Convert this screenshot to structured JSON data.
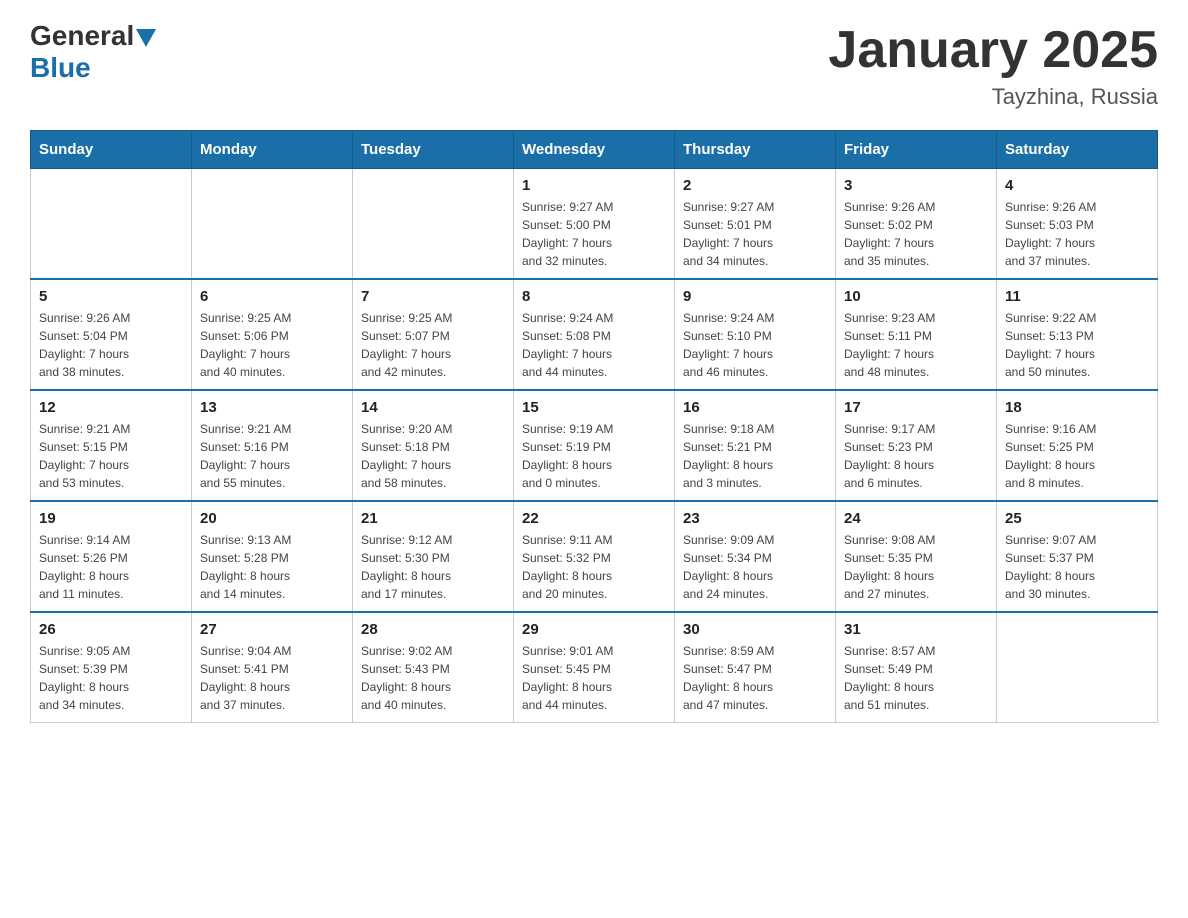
{
  "header": {
    "logo_general": "General",
    "logo_blue": "Blue",
    "title": "January 2025",
    "subtitle": "Tayzhina, Russia"
  },
  "weekdays": [
    "Sunday",
    "Monday",
    "Tuesday",
    "Wednesday",
    "Thursday",
    "Friday",
    "Saturday"
  ],
  "weeks": [
    [
      {
        "day": "",
        "info": ""
      },
      {
        "day": "",
        "info": ""
      },
      {
        "day": "",
        "info": ""
      },
      {
        "day": "1",
        "info": "Sunrise: 9:27 AM\nSunset: 5:00 PM\nDaylight: 7 hours\nand 32 minutes."
      },
      {
        "day": "2",
        "info": "Sunrise: 9:27 AM\nSunset: 5:01 PM\nDaylight: 7 hours\nand 34 minutes."
      },
      {
        "day": "3",
        "info": "Sunrise: 9:26 AM\nSunset: 5:02 PM\nDaylight: 7 hours\nand 35 minutes."
      },
      {
        "day": "4",
        "info": "Sunrise: 9:26 AM\nSunset: 5:03 PM\nDaylight: 7 hours\nand 37 minutes."
      }
    ],
    [
      {
        "day": "5",
        "info": "Sunrise: 9:26 AM\nSunset: 5:04 PM\nDaylight: 7 hours\nand 38 minutes."
      },
      {
        "day": "6",
        "info": "Sunrise: 9:25 AM\nSunset: 5:06 PM\nDaylight: 7 hours\nand 40 minutes."
      },
      {
        "day": "7",
        "info": "Sunrise: 9:25 AM\nSunset: 5:07 PM\nDaylight: 7 hours\nand 42 minutes."
      },
      {
        "day": "8",
        "info": "Sunrise: 9:24 AM\nSunset: 5:08 PM\nDaylight: 7 hours\nand 44 minutes."
      },
      {
        "day": "9",
        "info": "Sunrise: 9:24 AM\nSunset: 5:10 PM\nDaylight: 7 hours\nand 46 minutes."
      },
      {
        "day": "10",
        "info": "Sunrise: 9:23 AM\nSunset: 5:11 PM\nDaylight: 7 hours\nand 48 minutes."
      },
      {
        "day": "11",
        "info": "Sunrise: 9:22 AM\nSunset: 5:13 PM\nDaylight: 7 hours\nand 50 minutes."
      }
    ],
    [
      {
        "day": "12",
        "info": "Sunrise: 9:21 AM\nSunset: 5:15 PM\nDaylight: 7 hours\nand 53 minutes."
      },
      {
        "day": "13",
        "info": "Sunrise: 9:21 AM\nSunset: 5:16 PM\nDaylight: 7 hours\nand 55 minutes."
      },
      {
        "day": "14",
        "info": "Sunrise: 9:20 AM\nSunset: 5:18 PM\nDaylight: 7 hours\nand 58 minutes."
      },
      {
        "day": "15",
        "info": "Sunrise: 9:19 AM\nSunset: 5:19 PM\nDaylight: 8 hours\nand 0 minutes."
      },
      {
        "day": "16",
        "info": "Sunrise: 9:18 AM\nSunset: 5:21 PM\nDaylight: 8 hours\nand 3 minutes."
      },
      {
        "day": "17",
        "info": "Sunrise: 9:17 AM\nSunset: 5:23 PM\nDaylight: 8 hours\nand 6 minutes."
      },
      {
        "day": "18",
        "info": "Sunrise: 9:16 AM\nSunset: 5:25 PM\nDaylight: 8 hours\nand 8 minutes."
      }
    ],
    [
      {
        "day": "19",
        "info": "Sunrise: 9:14 AM\nSunset: 5:26 PM\nDaylight: 8 hours\nand 11 minutes."
      },
      {
        "day": "20",
        "info": "Sunrise: 9:13 AM\nSunset: 5:28 PM\nDaylight: 8 hours\nand 14 minutes."
      },
      {
        "day": "21",
        "info": "Sunrise: 9:12 AM\nSunset: 5:30 PM\nDaylight: 8 hours\nand 17 minutes."
      },
      {
        "day": "22",
        "info": "Sunrise: 9:11 AM\nSunset: 5:32 PM\nDaylight: 8 hours\nand 20 minutes."
      },
      {
        "day": "23",
        "info": "Sunrise: 9:09 AM\nSunset: 5:34 PM\nDaylight: 8 hours\nand 24 minutes."
      },
      {
        "day": "24",
        "info": "Sunrise: 9:08 AM\nSunset: 5:35 PM\nDaylight: 8 hours\nand 27 minutes."
      },
      {
        "day": "25",
        "info": "Sunrise: 9:07 AM\nSunset: 5:37 PM\nDaylight: 8 hours\nand 30 minutes."
      }
    ],
    [
      {
        "day": "26",
        "info": "Sunrise: 9:05 AM\nSunset: 5:39 PM\nDaylight: 8 hours\nand 34 minutes."
      },
      {
        "day": "27",
        "info": "Sunrise: 9:04 AM\nSunset: 5:41 PM\nDaylight: 8 hours\nand 37 minutes."
      },
      {
        "day": "28",
        "info": "Sunrise: 9:02 AM\nSunset: 5:43 PM\nDaylight: 8 hours\nand 40 minutes."
      },
      {
        "day": "29",
        "info": "Sunrise: 9:01 AM\nSunset: 5:45 PM\nDaylight: 8 hours\nand 44 minutes."
      },
      {
        "day": "30",
        "info": "Sunrise: 8:59 AM\nSunset: 5:47 PM\nDaylight: 8 hours\nand 47 minutes."
      },
      {
        "day": "31",
        "info": "Sunrise: 8:57 AM\nSunset: 5:49 PM\nDaylight: 8 hours\nand 51 minutes."
      },
      {
        "day": "",
        "info": ""
      }
    ]
  ]
}
